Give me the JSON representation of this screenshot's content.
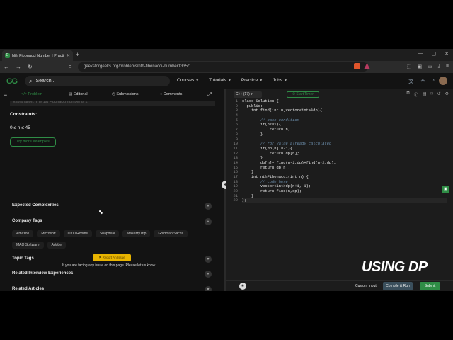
{
  "browser": {
    "tab_title": "Nth Fibonacci Number | Practice",
    "url": "geeksforgeeks.org/problems/nth-fibonacci-number1335/1"
  },
  "header": {
    "logo": "GG",
    "search_placeholder": "Search...",
    "menu": [
      "Courses",
      "Tutorials",
      "Practice",
      "Jobs"
    ]
  },
  "left": {
    "tabs": {
      "problem": "Problem",
      "editorial": "Editorial",
      "submissions": "Submissions",
      "comments": "Comments"
    },
    "explanation_snippet": "Explanation: The 1st Fibonacci number is 1.",
    "constraints_title": "Constraints:",
    "constraint": "0 ≤ n ≤ 45",
    "try_more": "Try more examples",
    "sections": {
      "expected_complexities": "Expected Complexities",
      "company_tags": "Company Tags",
      "topic_tags": "Topic Tags",
      "related_interview": "Related Interview Experiences",
      "related_articles": "Related Articles"
    },
    "company_tags": [
      "Amazon",
      "Microsoft",
      "OYO Rooms",
      "Snapdeal",
      "MakeMyTrip",
      "Goldman Sachs",
      "MAQ Software",
      "Adobe"
    ],
    "report_button": "Report An Issue",
    "report_text": "If you are facing any issue on this page. Please let us know."
  },
  "editor": {
    "language": "C++ (17)",
    "timer": "Start Timer",
    "lines": [
      {
        "n": "1",
        "t": "class Solution {"
      },
      {
        "n": "2",
        "t": "  public:"
      },
      {
        "n": "3",
        "t": "    int find(int n,vector<int>&dp){"
      },
      {
        "n": "4",
        "t": ""
      },
      {
        "n": "5",
        "t": "        // base condition",
        "c": true
      },
      {
        "n": "6",
        "t": "        if(n<=1){"
      },
      {
        "n": "7",
        "t": "            return n;"
      },
      {
        "n": "8",
        "t": "        }"
      },
      {
        "n": "9",
        "t": ""
      },
      {
        "n": "10",
        "t": "        // for value already calculated",
        "c": true
      },
      {
        "n": "11",
        "t": "        if(dp[n]!=-1){"
      },
      {
        "n": "12",
        "t": "            return dp[n];"
      },
      {
        "n": "13",
        "t": "        }"
      },
      {
        "n": "14",
        "t": "        dp[n]= find(n-1,dp)+find(n-2,dp);"
      },
      {
        "n": "15",
        "t": "        return dp[n];"
      },
      {
        "n": "16",
        "t": "    }"
      },
      {
        "n": "17",
        "t": "    int nthFibonacci(int n) {"
      },
      {
        "n": "18",
        "t": "        // code here",
        "c": true
      },
      {
        "n": "19",
        "t": "        vector<int>dp(n+1,-1);"
      },
      {
        "n": "20",
        "t": "        return find(n,dp);"
      },
      {
        "n": "21",
        "t": "    }"
      },
      {
        "n": "22",
        "t": "};"
      }
    ],
    "overlay_text": "USING DP",
    "custom_input": "Custom Input",
    "compile_run": "Compile & Run",
    "submit": "Submit"
  }
}
